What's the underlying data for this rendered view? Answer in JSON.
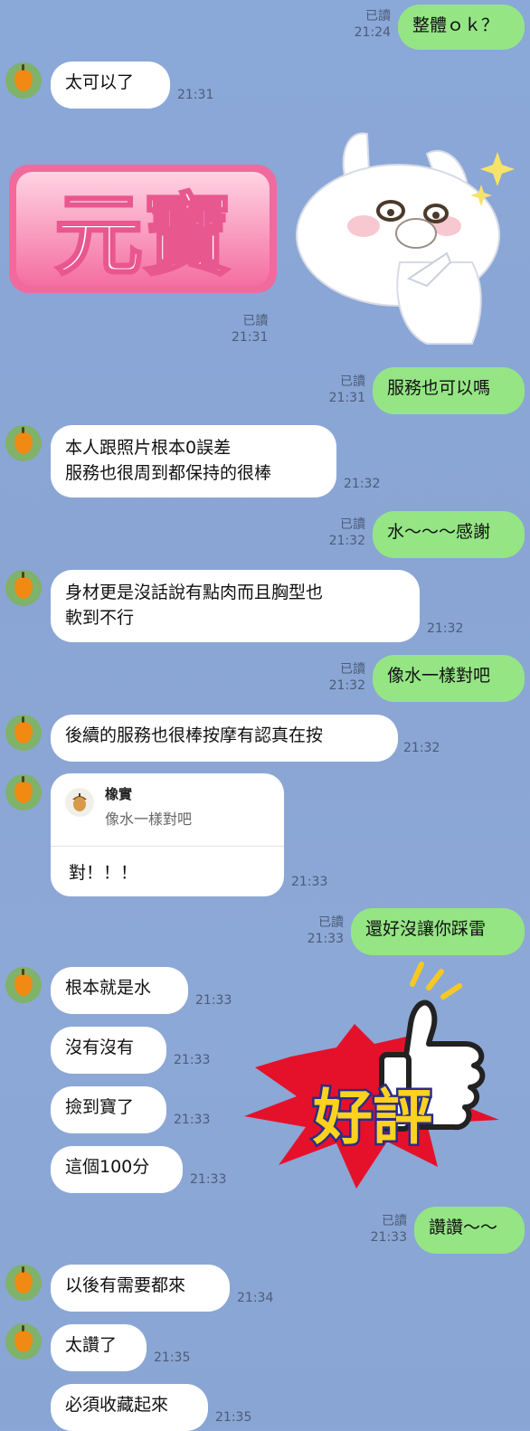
{
  "messages": {
    "m1": {
      "text": "整體ｏｋ？",
      "read": "已讀",
      "time": "21:24"
    },
    "m2": {
      "text": "太可以了",
      "time": "21:31"
    },
    "sticker1": {
      "caption": "元寶",
      "read": "已讀",
      "time": "21:31"
    },
    "m3": {
      "text": "服務也可以嗎",
      "read": "已讀",
      "time": "21:31"
    },
    "m4": {
      "text": "本人跟照片根本0誤差\n服務也很周到都保持的很棒",
      "time": "21:32"
    },
    "m5": {
      "text": "水〜〜〜感謝",
      "read": "已讀",
      "time": "21:32"
    },
    "m6": {
      "text": "身材更是沒話說有點肉而且胸型也\n軟到不行",
      "time": "21:32"
    },
    "m7": {
      "text": "像水一樣對吧",
      "read": "已讀",
      "time": "21:32"
    },
    "m8": {
      "text": "後續的服務也很棒按摩有認真在按",
      "time": "21:32"
    },
    "m9": {
      "quote_name": "橡實",
      "quote_text": "像水一樣對吧",
      "text": "對！！！",
      "time": "21:33"
    },
    "m10": {
      "text": "還好沒讓你踩雷",
      "read": "已讀",
      "time": "21:33"
    },
    "m11": {
      "text": "根本就是水",
      "time": "21:33"
    },
    "m12": {
      "text": "沒有沒有",
      "time": "21:33"
    },
    "m13": {
      "text": "撿到寶了",
      "time": "21:33"
    },
    "m14": {
      "text": "這個100分",
      "time": "21:33"
    },
    "sticker2": {
      "caption": "好評"
    },
    "m15": {
      "text": "讚讚〜〜",
      "read": "已讀",
      "time": "21:33"
    },
    "m16": {
      "text": "以後有需要都來",
      "time": "21:34"
    },
    "m17": {
      "text": "太讚了",
      "time": "21:35"
    },
    "m18": {
      "text": "必須收藏起來",
      "time": "21:35"
    }
  },
  "colors": {
    "incoming": "#ffffff",
    "outgoing": "#95e585",
    "background": "#8aa6d6",
    "avatar": "#7fb26a"
  },
  "icons": {
    "avatar": "persimmon-avatar-icon",
    "quote": "acorn-icon"
  }
}
